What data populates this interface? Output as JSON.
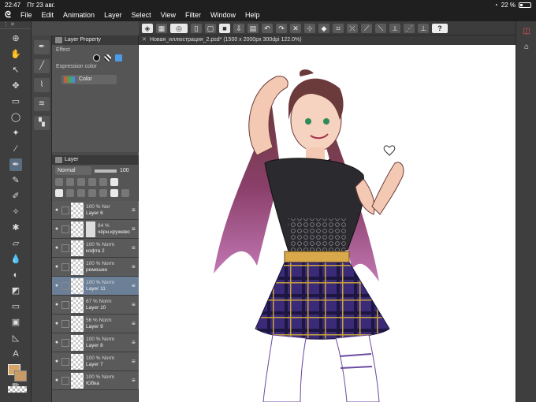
{
  "status": {
    "time": "22:47",
    "date": "Пт 23 авг.",
    "battery": "22 %",
    "battery_level": 0.22
  },
  "menu": [
    "File",
    "Edit",
    "Animation",
    "Layer",
    "Select",
    "View",
    "Filter",
    "Window",
    "Help"
  ],
  "property_panel": {
    "tab": "Layer Property",
    "effect_label": "Effect",
    "expression_label": "Expression color",
    "expression_value": "Color"
  },
  "layer_panel": {
    "tab": "Layer",
    "blend_mode": "Normal",
    "opacity": "100",
    "layers": [
      {
        "meta": "100 % Nor",
        "name": "Layer 6",
        "selected": false,
        "mask": false
      },
      {
        "meta": "84 %",
        "name": "чёрн.кружево",
        "selected": false,
        "mask": true
      },
      {
        "meta": "100 % Norm",
        "name": "кофта 2",
        "selected": false,
        "mask": false
      },
      {
        "meta": "100 % Norm",
        "name": "ремешки",
        "selected": false,
        "mask": false
      },
      {
        "meta": "100 % Norm",
        "name": "Layer 11",
        "selected": true,
        "mask": false
      },
      {
        "meta": "67 % Norm",
        "name": "Layer 10",
        "selected": false,
        "mask": false
      },
      {
        "meta": "56 % Norm",
        "name": "Layer 9",
        "selected": false,
        "mask": false
      },
      {
        "meta": "100 % Norm",
        "name": "Layer 8",
        "selected": false,
        "mask": false
      },
      {
        "meta": "100 % Norm",
        "name": "Layer 7",
        "selected": false,
        "mask": false
      },
      {
        "meta": "100 % Norm",
        "name": "Юбка",
        "selected": false,
        "mask": false
      }
    ]
  },
  "document": {
    "title": "Новая_иллюстрация_2.psd* (1500 x 2000px 300dpi 122.0%)"
  },
  "colors": {
    "main": "#d7a76a",
    "sub": "#c79a66",
    "selection": "#6b7f96"
  },
  "help_label": "?"
}
